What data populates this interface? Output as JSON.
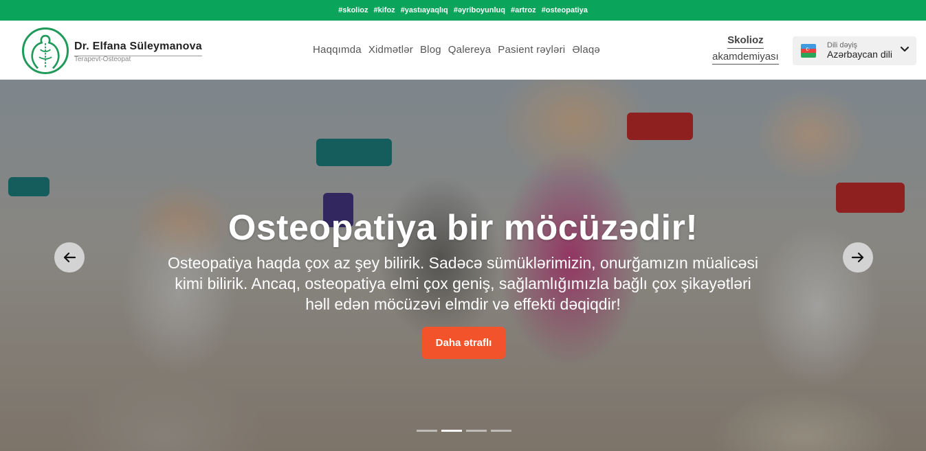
{
  "topbar": {
    "tags": [
      "#skolioz",
      "#kifoz",
      "#yastıayaqlıq",
      "#əyriboyunluq",
      "#artroz",
      "#osteopatiya"
    ]
  },
  "brand": {
    "name": "Dr. Elfana Süleymanova",
    "subtitle": "Terapevt-Osteopat"
  },
  "nav": {
    "items": [
      "Haqqımda",
      "Xidmətlər",
      "Blog",
      "Qalereya",
      "Pasient rəyləri",
      "Əlaqə"
    ]
  },
  "academy": {
    "line1": "Skolioz",
    "line2": "akamdemiyası"
  },
  "language": {
    "label": "Dili dəyiş",
    "current": "Azərbaycan dili"
  },
  "hero": {
    "title": "Osteopatiya bir möcüzədir!",
    "text_line1": "Osteopatiya haqda çox az şey bilirik. Sadəcə sümüklərimizin, onurğamızın müalicəsi",
    "text_line2": "kimi bilirik. Ancaq, osteopatiya elmi çox geniş, sağlamlığımızla bağlı çox şikayətləri",
    "text_line3": "həll edən möcüzəvi elmdir və effekti dəqiqdir!",
    "button": "Daha ətraflı",
    "slide_count": 4,
    "active_slide": 2
  },
  "colors": {
    "topbar": "#0aa45a",
    "accent_button": "#f2532a",
    "logo_green": "#1f9a5a"
  }
}
